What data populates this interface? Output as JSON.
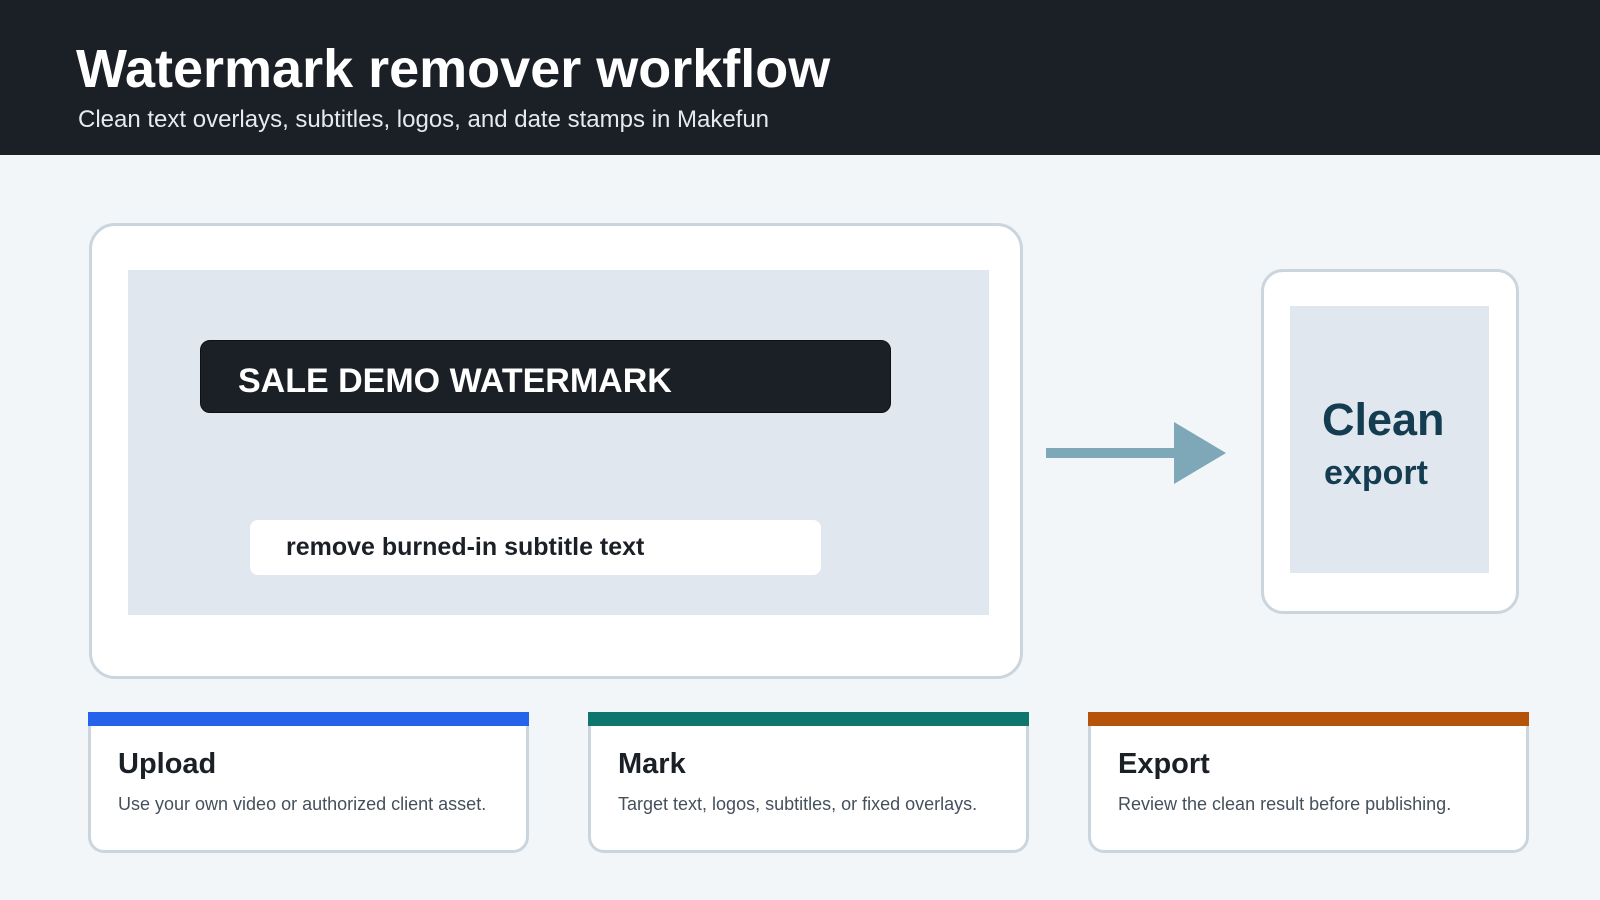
{
  "header": {
    "title": "Watermark remover workflow",
    "subtitle": "Clean text overlays, subtitles, logos, and date stamps in Makefun"
  },
  "source": {
    "watermark_text": "SALE DEMO WATERMARK",
    "subtitle_text": "remove burned-in subtitle text"
  },
  "output": {
    "clean_label": "Clean",
    "export_label": "export"
  },
  "colors": {
    "header_bg": "#1b2027",
    "arrow": "#7ea7b8",
    "upload_accent": "#2563eb",
    "mark_accent": "#0f766e",
    "export_accent": "#b45309"
  },
  "steps": [
    {
      "title": "Upload",
      "description": "Use your own video or authorized client asset.",
      "accent": "#2563eb"
    },
    {
      "title": "Mark",
      "description": "Target text, logos, subtitles, or fixed overlays.",
      "accent": "#0f766e"
    },
    {
      "title": "Export",
      "description": "Review the clean result before publishing.",
      "accent": "#b45309"
    }
  ]
}
